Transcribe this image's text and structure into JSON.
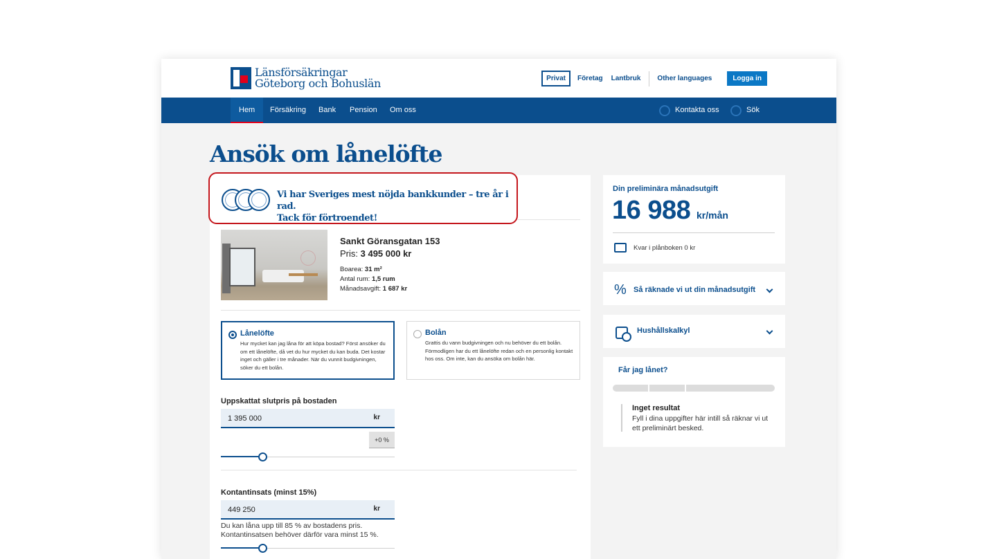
{
  "header": {
    "logo_line1": "Länsförsäkringar",
    "logo_line2": "Göteborg och Bohuslän",
    "segments": [
      "Privat",
      "Företag",
      "Lantbruk"
    ],
    "other_languages": "Other languages",
    "login": "Logga in"
  },
  "nav": {
    "items": [
      "Hem",
      "Försäkring",
      "Bank",
      "Pension",
      "Om oss"
    ],
    "active": "Hem",
    "contact": "Kontakta oss",
    "search": "Sök"
  },
  "page": {
    "title": "Ansök om lånelöfte"
  },
  "banner": {
    "line1": "Vi har Sveriges mest nöjda bankkunder – tre år i rad.",
    "line2": "Tack för förtroendet!"
  },
  "property": {
    "address": "Sankt Göransgatan 153",
    "price_label": "Pris:",
    "price_value": "3 495 000 kr",
    "facts": [
      {
        "label": "Boarea:",
        "value": "31 m²"
      },
      {
        "label": "Antal rum:",
        "value": "1,5 rum"
      },
      {
        "label": "Månadsavgift:",
        "value": "1 687 kr"
      }
    ]
  },
  "options": [
    {
      "title": "Lånelöfte",
      "selected": true,
      "body": "Hur mycket kan jag låna för att köpa bostad? Först ansöker du om ett lånelöfte, då vet du hur mycket du kan buda. Det kostar inget och gäller i tre månader. När du vunnit budgivningen, söker du ett bolån."
    },
    {
      "title": "Bolån",
      "selected": false,
      "body": "Grattis du vann budgivningen och nu behöver du ett bolån. Förmodligen har du ett lånelöfte redan och en personlig kontakt hos oss. Om inte, kan du ansöka om bolån här."
    }
  ],
  "price_field": {
    "label": "Uppskattat slutpris på bostaden",
    "value": "1 395 000",
    "unit": "kr",
    "change": "+0 %",
    "slider_fraction": 0.24
  },
  "downpayment_field": {
    "label": "Kontantinsats (minst 15%)",
    "value": "449 250",
    "unit": "kr",
    "hint_line1": "Du kan låna upp till 85 % av bostadens pris.",
    "hint_line2": "Kontantinsatsen behöver därför vara minst 15 %.",
    "slider_fraction": 0.24
  },
  "summary": {
    "label": "Din preliminära månadsutgift",
    "amount": "16 988",
    "unit": "kr/mån",
    "left_in_wallet": "Kvar i plånboken 0 kr"
  },
  "accordions": {
    "calc": "Så räknade vi ut din månadsutgift",
    "household": "Hushållskalkyl"
  },
  "loan_check": {
    "title": "Får jag lånet?",
    "result_title": "Inget resultat",
    "result_body": "Fyll i dina uppgifter här intill så räknar vi ut ett preliminärt besked."
  }
}
